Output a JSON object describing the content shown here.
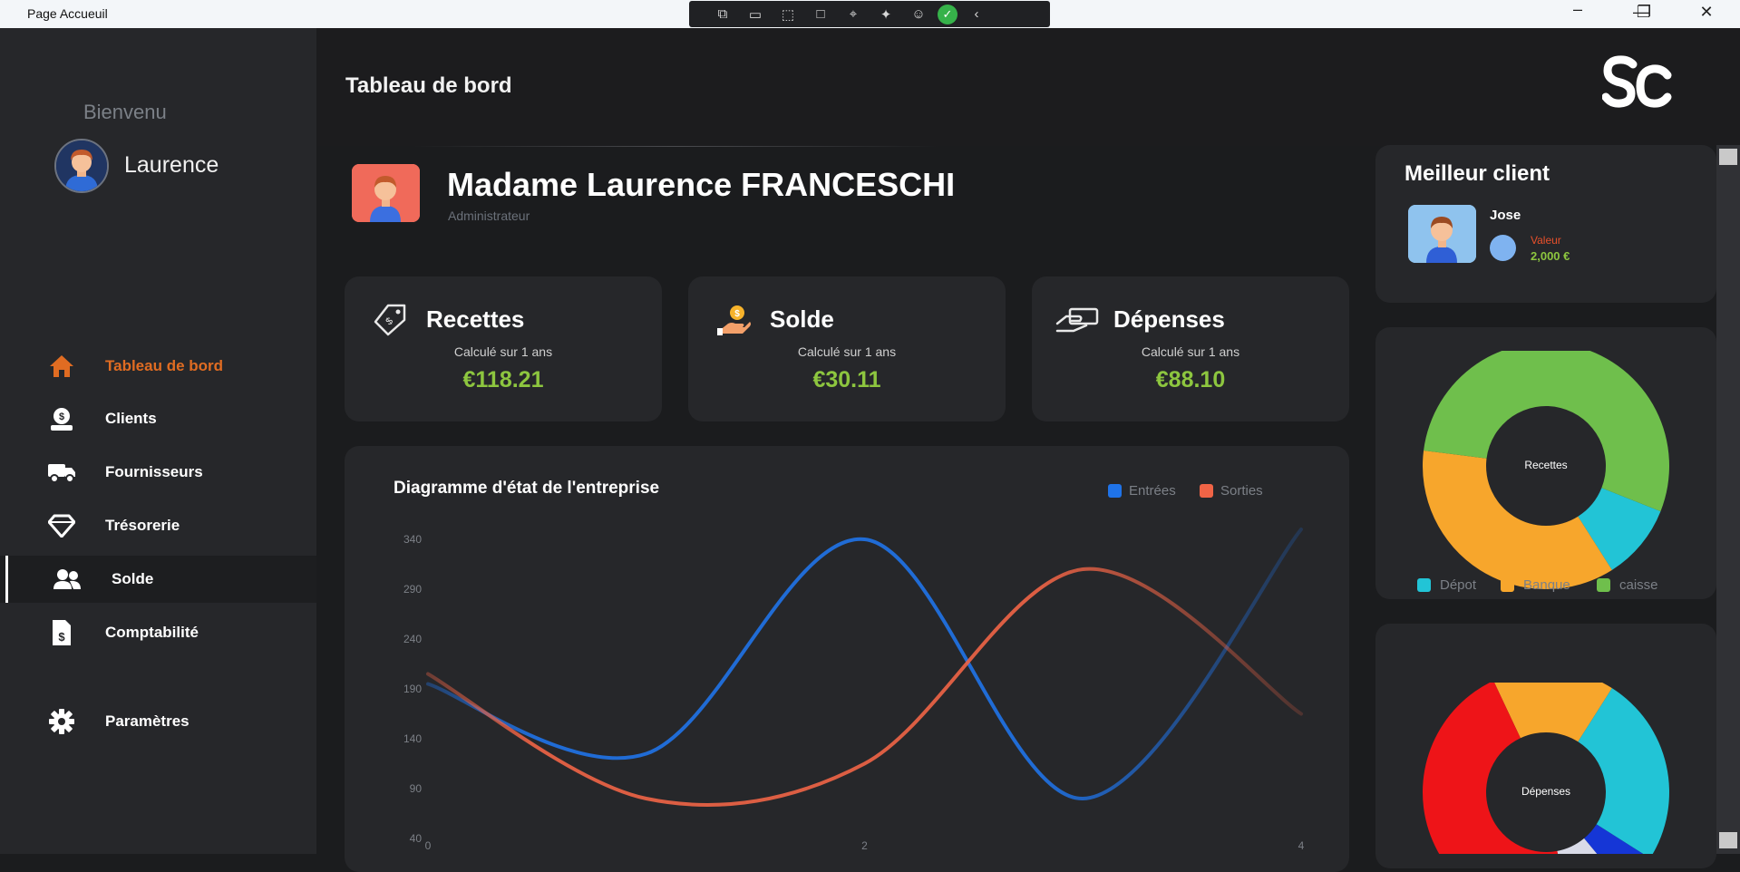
{
  "window": {
    "title": "Page Accueuil"
  },
  "sidebar": {
    "welcome": "Bienvenu",
    "username": "Laurence",
    "items": [
      {
        "label": "Tableau de bord",
        "icon": "home-icon"
      },
      {
        "label": "Clients",
        "icon": "money-bag-icon"
      },
      {
        "label": "Fournisseurs",
        "icon": "truck-icon"
      },
      {
        "label": "Trésorerie",
        "icon": "diamond-icon"
      },
      {
        "label": "Solde",
        "icon": "users-icon"
      },
      {
        "label": "Comptabilité",
        "icon": "invoice-icon"
      },
      {
        "label": "Paramètres",
        "icon": "gear-icon"
      }
    ],
    "active_color": "#e06c22"
  },
  "header": {
    "title": "Tableau de bord",
    "logo": "Sc"
  },
  "profile": {
    "name": "Madame Laurence FRANCESCHI",
    "role": "Administrateur"
  },
  "stats": [
    {
      "title": "Recettes",
      "subtitle": "Calculé sur 1 ans",
      "value": "€118.21",
      "icon": "price-tag-icon"
    },
    {
      "title": "Solde",
      "subtitle": "Calculé sur 1 ans",
      "value": "€30.11",
      "icon": "hand-coin-icon"
    },
    {
      "title": "Dépenses",
      "subtitle": "Calculé sur  1 ans",
      "value": "€88.10",
      "icon": "hand-pay-icon"
    }
  ],
  "value_color": "#8dc63f",
  "best_client": {
    "title": "Meilleur client",
    "name": "Jose",
    "value_label": "Valeur",
    "value": "2,000 €"
  },
  "chart_data": [
    {
      "type": "line",
      "title": "Diagramme d'état de l'entreprise",
      "x": [
        0,
        1,
        2,
        3,
        4
      ],
      "xticks": [
        "0",
        "2",
        "4"
      ],
      "yticks": [
        "40",
        "90",
        "140",
        "190",
        "240",
        "290",
        "340"
      ],
      "ylim": [
        40,
        340
      ],
      "xlim": [
        0,
        4
      ],
      "series": [
        {
          "name": "Entrées",
          "color": "#1f73e8",
          "values": [
            195,
            125,
            340,
            80,
            350
          ]
        },
        {
          "name": "Sorties",
          "color": "#f06446",
          "values": [
            205,
            80,
            115,
            310,
            165
          ]
        }
      ],
      "legend": "top-right",
      "grid": false
    },
    {
      "type": "pie",
      "title": "Recettes",
      "labels": [
        "Dépot",
        "Banque",
        "caisse"
      ],
      "values": [
        10,
        36,
        54
      ],
      "colors": [
        "#22c4d6",
        "#f7a62c",
        "#6fbf4c"
      ],
      "legend": "bottom"
    },
    {
      "type": "pie",
      "title": "Dépenses",
      "labels": [],
      "values": [
        16,
        25,
        5,
        8,
        46
      ],
      "colors": [
        "#f7a62c",
        "#22c4d6",
        "#1536d6",
        "#d9dbe8",
        "#ee1418"
      ]
    }
  ]
}
